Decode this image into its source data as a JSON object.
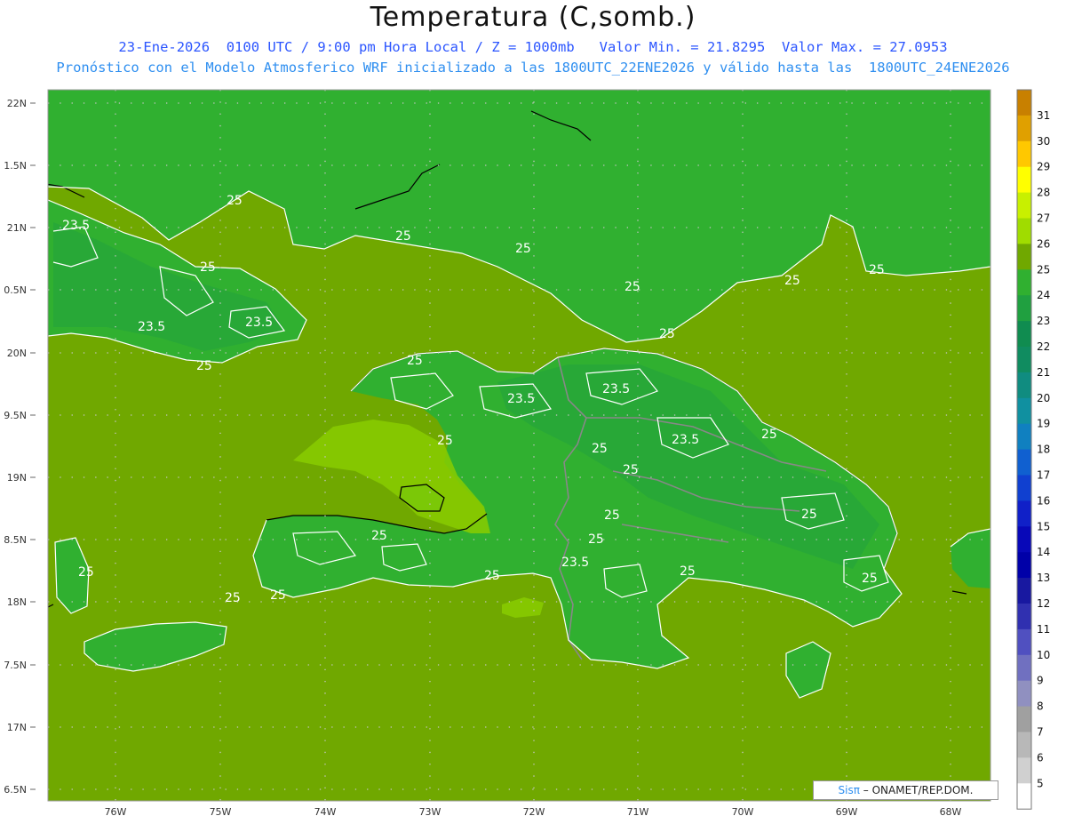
{
  "header": {
    "title": "Temperatura (C,somb.)",
    "line1": "23-Ene-2026  0100 UTC / 9:00 pm Hora Local / Z = 1000mb   Valor Min. = 21.8295  Valor Max. = 27.0953",
    "line2": "Pronóstico con el Modelo Atmosferico WRF inicializado a las 1800UTC_22ENE2026 y válido hasta las  1800UTC_24ENE2026"
  },
  "axes": {
    "lat_labels": [
      "22N",
      "1.5N",
      "21N",
      "0.5N",
      "20N",
      "9.5N",
      "19N",
      "8.5N",
      "18N",
      "7.5N",
      "17N",
      "6.5N"
    ],
    "lon_labels": [
      "76W",
      "75W",
      "74W",
      "73W",
      "72W",
      "71W",
      "70W",
      "69W",
      "68W"
    ]
  },
  "map": {
    "ocean_color": "#70a800",
    "land_color": "#30b030",
    "highlands_color": "#20a040",
    "warm_water_color": "#88cc00",
    "contour_labels": [
      "25",
      "23.5",
      "25",
      "25",
      "23.5",
      "25",
      "25",
      "25",
      "25",
      "25",
      "23.5",
      "25",
      "23.5",
      "25",
      "23.5",
      "25",
      "23.5",
      "25",
      "25",
      "25",
      "25",
      "25",
      "25",
      "25",
      "23.5",
      "25",
      "25",
      "25",
      "25",
      "25",
      "25"
    ]
  },
  "colorbar": {
    "labels": [
      "31",
      "30",
      "29",
      "28",
      "27",
      "26",
      "25",
      "24",
      "23",
      "22",
      "21",
      "20",
      "19",
      "18",
      "17",
      "16",
      "15",
      "14",
      "13",
      "12",
      "11",
      "10",
      "9",
      "8",
      "7",
      "6",
      "5"
    ],
    "colors": [
      "#c88000",
      "#e0a000",
      "#ffc800",
      "#ffff00",
      "#c8f000",
      "#a0dc00",
      "#70a800",
      "#30b030",
      "#20a040",
      "#108c50",
      "#108c60",
      "#108c80",
      "#1090a0",
      "#1080c0",
      "#1060d0",
      "#1040d0",
      "#1020c8",
      "#0808b8",
      "#0000a8",
      "#1818a0",
      "#3030b0",
      "#5050c0",
      "#7070c0",
      "#9090c0",
      "#a0a0a0",
      "#b8b8b8",
      "#d0d0d0",
      "#ffffff"
    ]
  },
  "credit": {
    "sis": "Sisπ",
    "text": "– ONAMET/REP.DOM."
  }
}
